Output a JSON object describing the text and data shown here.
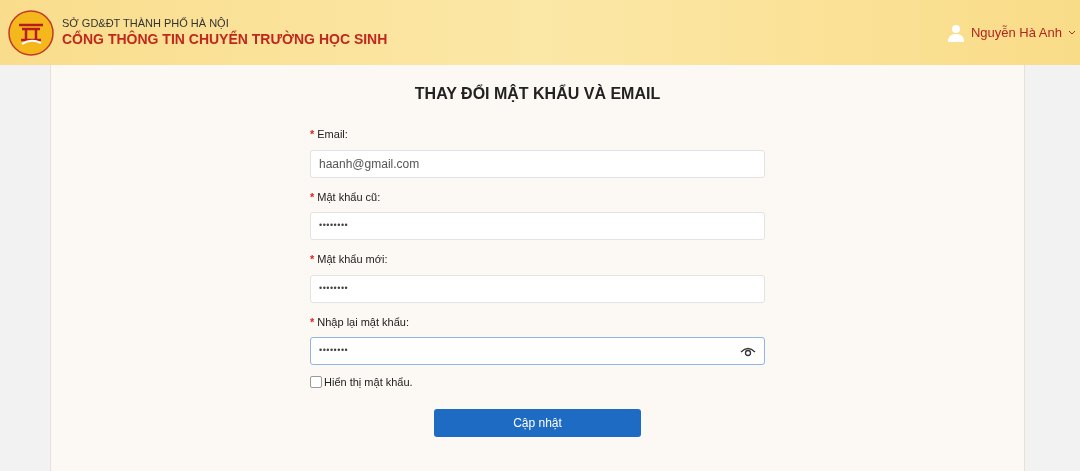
{
  "header": {
    "department": "SỞ GD&ĐT THÀNH PHỐ HÀ NỘI",
    "portal_title": "CỔNG THÔNG TIN CHUYỂN TRƯỜNG HỌC SINH",
    "user_name": "Nguyễn Hà Anh"
  },
  "form": {
    "title": "THAY ĐỔI MẬT KHẨU VÀ EMAIL",
    "fields": [
      {
        "required_mark": "*",
        "label": "Email:",
        "kind": "text",
        "value": "haanh@gmail.com",
        "focused": false,
        "reveal_toggle": false
      },
      {
        "required_mark": "*",
        "label": "Mật khẩu cũ:",
        "kind": "password",
        "value": "••••••••",
        "focused": false,
        "reveal_toggle": false
      },
      {
        "required_mark": "*",
        "label": "Mật khẩu mới:",
        "kind": "password",
        "value": "••••••••",
        "focused": false,
        "reveal_toggle": false
      },
      {
        "required_mark": "*",
        "label": "Nhập lại mật khẩu:",
        "kind": "password",
        "value": "••••••••",
        "focused": true,
        "reveal_toggle": true
      }
    ],
    "show_password": {
      "label": "Hiển thị mật khẩu.",
      "checked": false
    },
    "submit": "Cập nhật"
  }
}
